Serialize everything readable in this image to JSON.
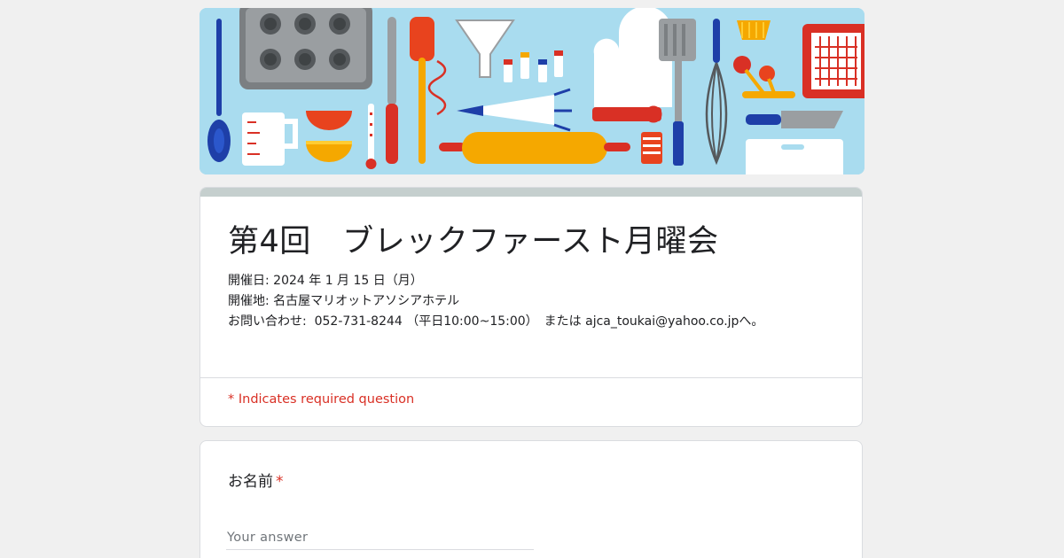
{
  "colors": {
    "background": "#f0f0f0",
    "banner_background": "#a9dcef",
    "card": "#ffffff",
    "title_topbar": "#c5cfce",
    "required_red": "#d93025"
  },
  "banner": {
    "icons": [
      "muffin-tray-icon",
      "spoon-icon",
      "measuring-cup-icon",
      "bowl-icon",
      "thermometer-icon",
      "knife-icon",
      "spatula-icon",
      "funnel-icon",
      "spice-bottles-icon",
      "piping-bag-icon",
      "oven-mitt-icon",
      "turner-icon",
      "rolling-pin-icon",
      "whisk-icon",
      "measuring-spoons-icon",
      "kitchen-knife-icon",
      "cooling-rack-icon",
      "cutting-board-icon",
      "cupcake-liner-icon",
      "pastry-brush-icon"
    ]
  },
  "form": {
    "title": "第4回　ブレックファースト月曜会",
    "description": [
      "開催日: 2024 年 1 月 15 日（月）",
      "開催地: 名古屋マリオットアソシアホテル",
      "お問い合わせ:  052-731-8244 （平日10:00~15:00）　または ajca_toukai@yahoo.co.jpへ。"
    ],
    "required_note": "* Indicates required question"
  },
  "question": {
    "label": "お名前",
    "required_mark": "*",
    "placeholder": "Your answer"
  }
}
